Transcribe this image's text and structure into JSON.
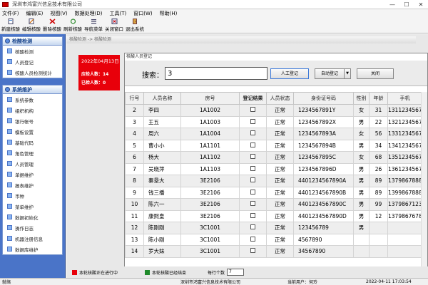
{
  "window": {
    "title": "深圳市鸿富兴信息技术有限公司",
    "controls": {
      "min": "—",
      "max": "☐",
      "close": "✕"
    }
  },
  "menu": [
    "文件(F)",
    "编辑(E)",
    "视图(V)",
    "数据处理(D)",
    "工具(T)",
    "窗口(W)",
    "帮助(H)"
  ],
  "toolbar": [
    "新建核酸",
    "编辑核酸",
    "删除核酸",
    "刷新核酸",
    "导航菜单",
    "关闭窗口",
    "退出系统"
  ],
  "sidebar": {
    "panel1": {
      "title": "检酸检测",
      "items": [
        "核酸检测",
        "人员登记",
        "核酸人员检测统计"
      ]
    },
    "panel2": {
      "title": "系统维护",
      "items": [
        "系统参数",
        "组织机构",
        "银行帐号",
        "模板设置",
        "基础代码",
        "角色管理",
        "人员管理",
        "单据维护",
        "报表维护",
        "币种",
        "菜单维护",
        "数据初始化",
        "操作日志",
        "机器注册信息",
        "数据库维护"
      ]
    }
  },
  "workspace": {
    "breadcrumb": "核酸检测 -> 核酸检测",
    "stats": {
      "date": "2022年04月13日",
      "should_detect": "应检人数：14",
      "detected": "已检人数：0"
    }
  },
  "dialog": {
    "title": "核酸人员登记",
    "search_label": "搜索：",
    "search_value": "3",
    "buttons": {
      "manual": "人工登记",
      "auto": "自动登记",
      "auto_dropdown": "▼",
      "close": "关闭"
    },
    "columns": [
      "行号",
      "人员名称",
      "房号",
      "登记结果",
      "人员状态",
      "身份证号码",
      "性别",
      "年龄",
      "手机"
    ],
    "rows": [
      {
        "no": "2",
        "name": "李四",
        "room": "1A1002",
        "status": "正常",
        "id": "1234567891Y",
        "gender": "女",
        "age": "31",
        "phone": "13112345678"
      },
      {
        "no": "3",
        "name": "王五",
        "room": "1A1003",
        "status": "正常",
        "id": "1234567892X",
        "gender": "男",
        "age": "22",
        "phone": "13212345678"
      },
      {
        "no": "4",
        "name": "周六",
        "room": "1A1004",
        "status": "正常",
        "id": "1234567893A",
        "gender": "女",
        "age": "56",
        "phone": "13312345678"
      },
      {
        "no": "5",
        "name": "曹小小",
        "room": "1A1101",
        "status": "正常",
        "id": "1234567894B",
        "gender": "男",
        "age": "34",
        "phone": "13412345678"
      },
      {
        "no": "6",
        "name": "杨大",
        "room": "1A1102",
        "status": "正常",
        "id": "1234567895C",
        "gender": "女",
        "age": "68",
        "phone": "13512345678"
      },
      {
        "no": "7",
        "name": "吴晓萍",
        "room": "1A1103",
        "status": "正常",
        "id": "1234567896D",
        "gender": "男",
        "age": "26",
        "phone": "13612345678"
      },
      {
        "no": "8",
        "name": "秦垦大",
        "room": "3E2106",
        "status": "正常",
        "id": "4401234567890A",
        "gender": "男",
        "age": "89",
        "phone": "13798678888"
      },
      {
        "no": "9",
        "name": "钱三播",
        "room": "3E2106",
        "status": "正常",
        "id": "4401234567890B",
        "gender": "男",
        "age": "89",
        "phone": "13998678888"
      },
      {
        "no": "10",
        "name": "陈六一",
        "room": "3E2106",
        "status": "正常",
        "id": "4401234567890C",
        "gender": "男",
        "age": "99",
        "phone": "13798671234"
      },
      {
        "no": "11",
        "name": "康熙皇",
        "room": "3E2106",
        "status": "正常",
        "id": "4401234567890D",
        "gender": "男",
        "age": "12",
        "phone": "13798676789"
      },
      {
        "no": "12",
        "name": "陈刚刚",
        "room": "3C1001",
        "status": "正常",
        "id": "123456789",
        "gender": "男",
        "age": "",
        "phone": ""
      },
      {
        "no": "13",
        "name": "陈小刚",
        "room": "3C1001",
        "status": "正常",
        "id": "4567890",
        "gender": "",
        "age": "",
        "phone": ""
      },
      {
        "no": "14",
        "name": "罗大妹",
        "room": "3C1001",
        "status": "正常",
        "id": "34567890",
        "gender": "",
        "age": "",
        "phone": ""
      }
    ]
  },
  "legend": {
    "red_label": "本轮核酸正在进行中",
    "green_label": "本轮核酸已经结束",
    "per_page_label": "每行个数",
    "per_page_value": "7"
  },
  "statusbar": {
    "ready": "就绪",
    "company": "深圳市鸿富兴信息技术有限公司",
    "user": "当前用户：何玲",
    "datetime": "2022-04-11 17:03:54"
  },
  "colors": {
    "sidebar": "#4a74c8",
    "stats_panel": "#e8000a",
    "legend_red": "#e8000a",
    "legend_green": "#1f8a2a"
  }
}
